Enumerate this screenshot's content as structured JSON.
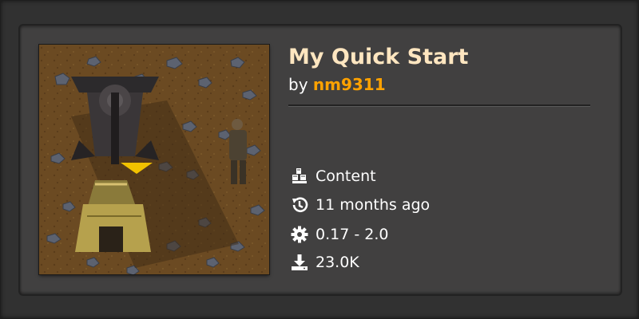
{
  "mod": {
    "title": "My Quick Start",
    "by_label": "by",
    "author": "nm9311"
  },
  "info": [
    {
      "icon": "cubes-icon",
      "text": "Content"
    },
    {
      "icon": "history-icon",
      "text": "11 months ago"
    },
    {
      "icon": "gear-icon",
      "text": "0.17 - 2.0"
    },
    {
      "icon": "download-icon",
      "text": "23.0K"
    }
  ],
  "colors": {
    "title": "#ffe6c0",
    "author": "#ffa200",
    "card_bg": "#414040"
  }
}
